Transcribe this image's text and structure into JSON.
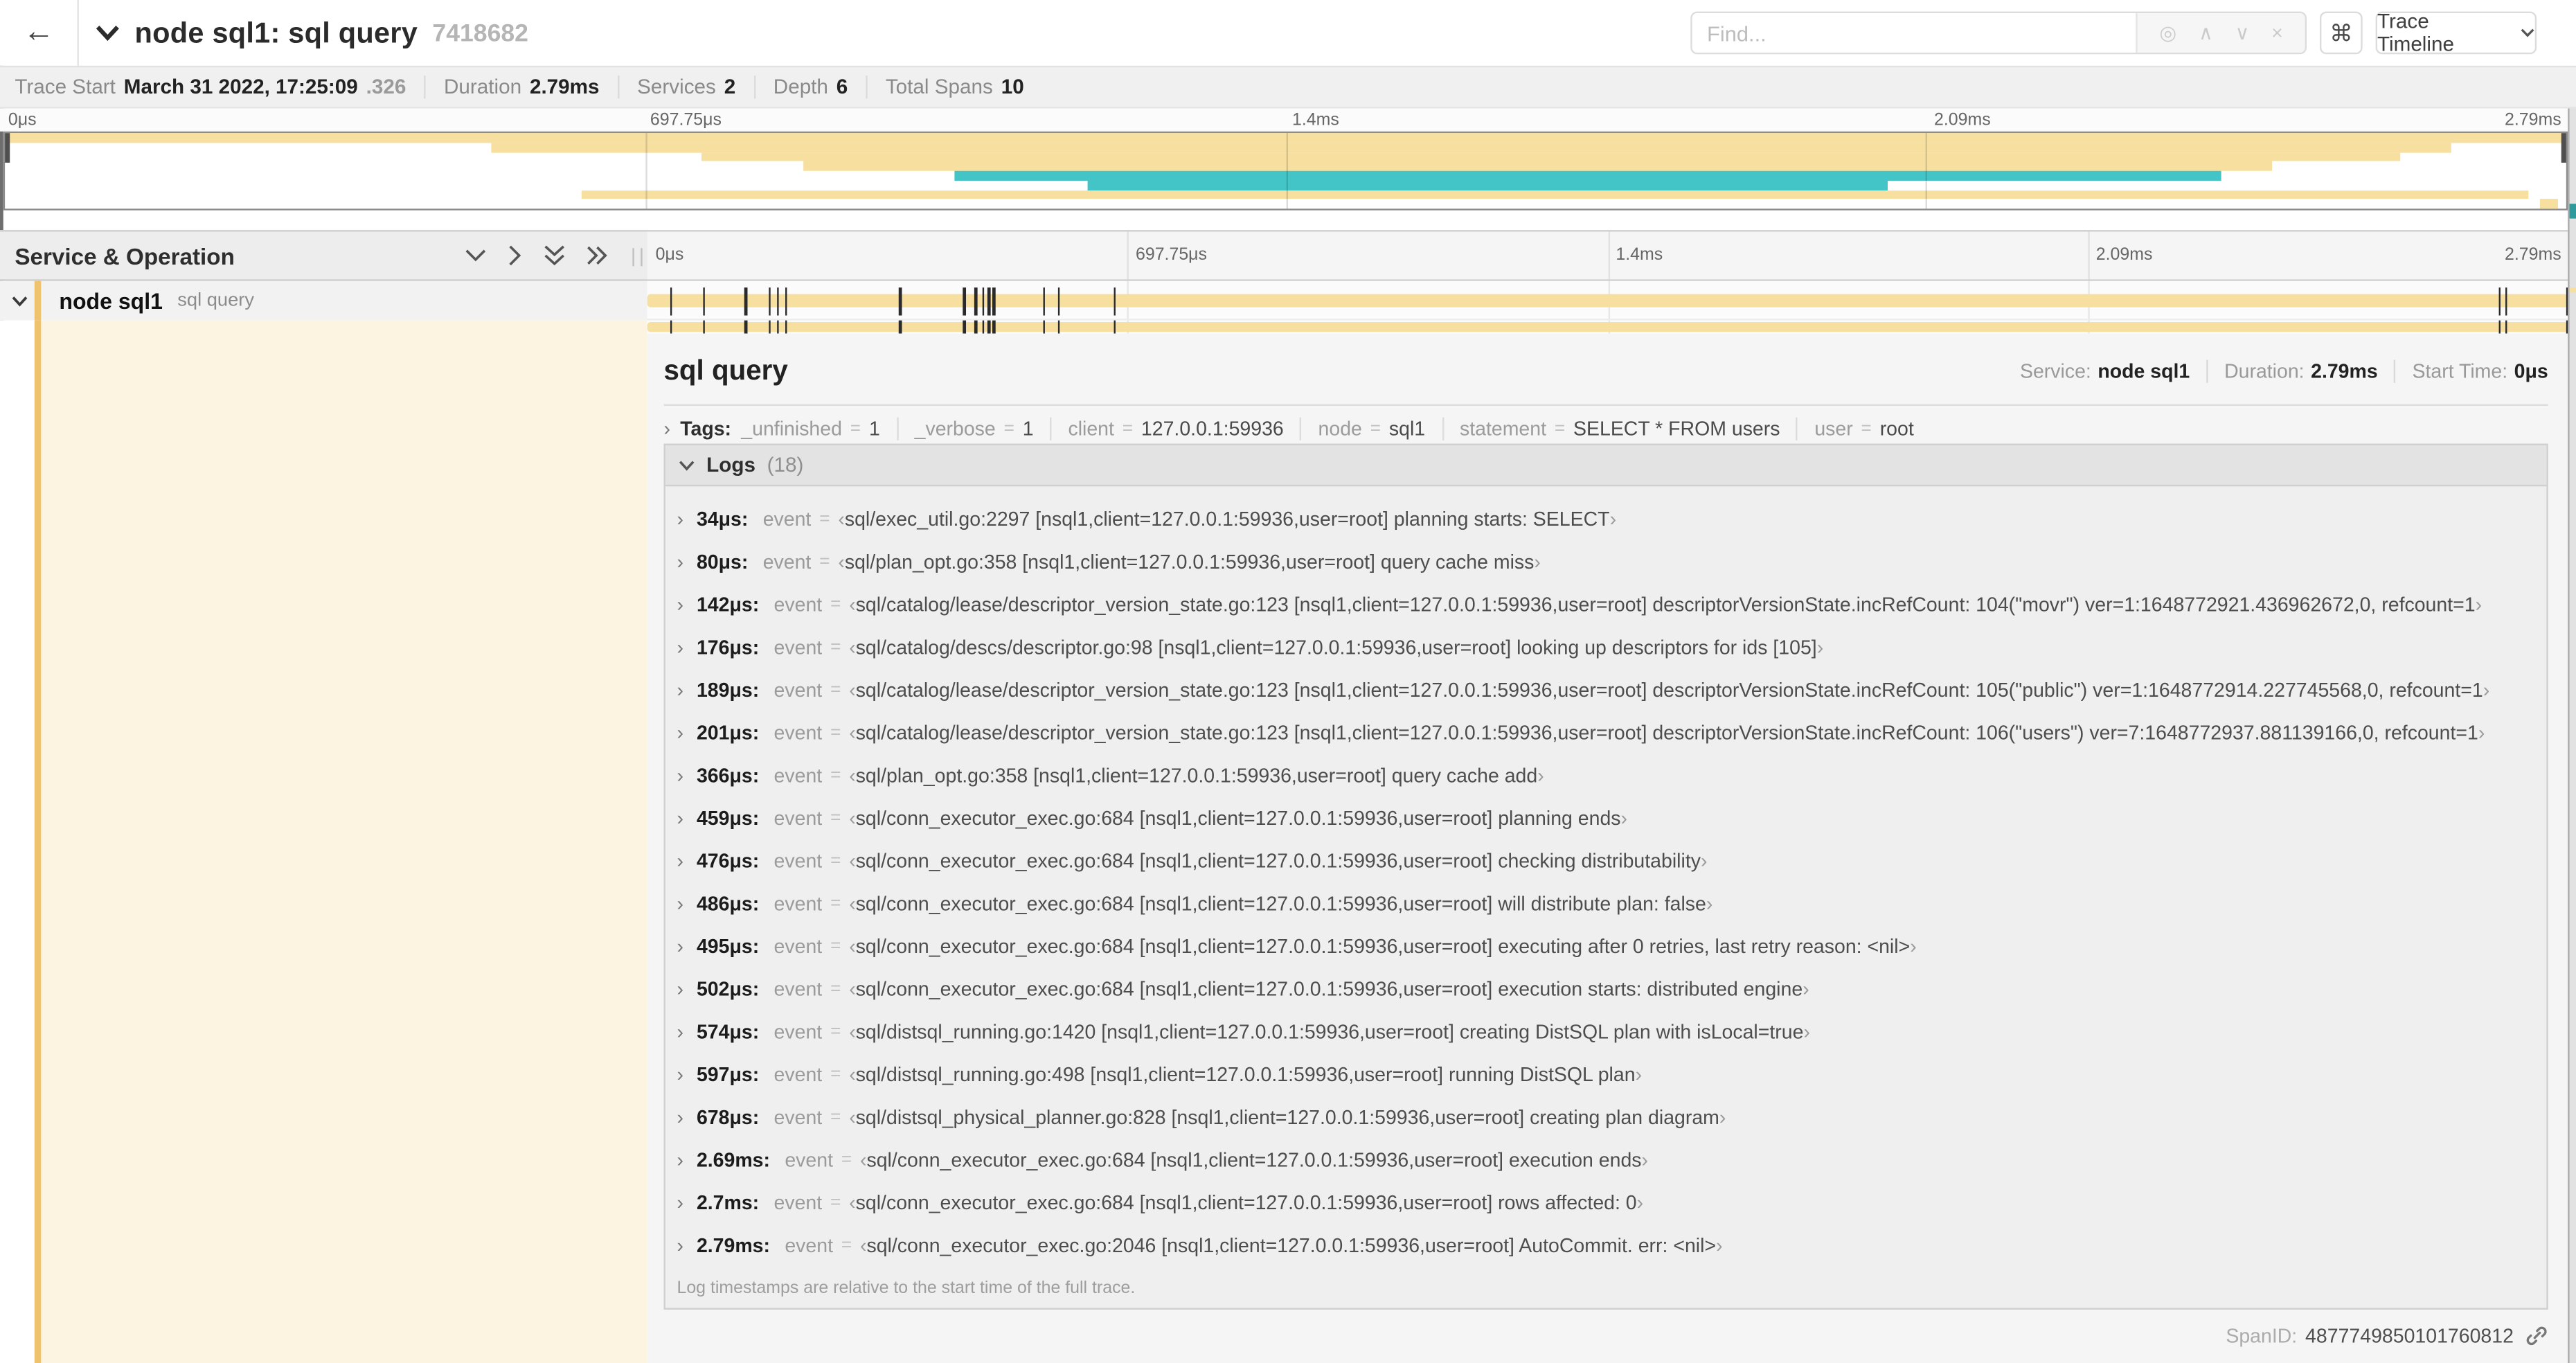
{
  "colors": {
    "tan": "#F7DF9F",
    "teal": "#43C4C6",
    "accent": "#EFC26D",
    "cream": "#FCF4E1"
  },
  "header": {
    "back_arrow": "←",
    "title": "node sql1: sql query",
    "trace_id": "7418682",
    "find_placeholder": "Find...",
    "find_tool_icons": [
      "locate-icon",
      "prev-icon",
      "next-icon",
      "clear-icon"
    ],
    "keyboard_shortcut": "⌘",
    "view_selector": "Trace Timeline"
  },
  "stats": [
    {
      "label": "Trace Start",
      "value": "March 31 2022, 17:25:09",
      "suffix": ".326"
    },
    {
      "label": "Duration",
      "value": "2.79ms",
      "suffix": ""
    },
    {
      "label": "Services",
      "value": "2",
      "suffix": ""
    },
    {
      "label": "Depth",
      "value": "6",
      "suffix": ""
    },
    {
      "label": "Total Spans",
      "value": "10",
      "suffix": ""
    }
  ],
  "timeline": {
    "ticks": [
      "0μs",
      "697.75μs",
      "1.4ms",
      "2.09ms",
      "2.79ms"
    ],
    "duration_us": 2790,
    "log_ticks_us": [
      34,
      80,
      142,
      176,
      189,
      201,
      366,
      459,
      476,
      486,
      495,
      502,
      574,
      597,
      678,
      2690,
      2700,
      2790
    ]
  },
  "minimap": {
    "rows": [
      {
        "color": "tan",
        "start": 0,
        "end": 100
      },
      {
        "color": "tan",
        "start": 19,
        "end": 95.5
      },
      {
        "color": "tan",
        "start": 27.2,
        "end": 93.5
      },
      {
        "color": "tan",
        "start": 31.2,
        "end": 88.5
      },
      {
        "color": "teal",
        "start": 37.1,
        "end": 86.5
      },
      {
        "color": "teal",
        "start": 42.3,
        "end": 73.5
      },
      {
        "color": "tan",
        "start": 22.5,
        "end": 98.5
      },
      {
        "color": "tan",
        "start": 99,
        "end": 99.7
      }
    ]
  },
  "grid_header": {
    "service_column": "Service & Operation"
  },
  "span_row": {
    "service": "node sql1",
    "operation": "sql query"
  },
  "detail": {
    "title": "sql query",
    "info": [
      {
        "label": "Service:",
        "value": "node sql1"
      },
      {
        "label": "Duration:",
        "value": "2.79ms"
      },
      {
        "label": "Start Time:",
        "value": "0μs"
      }
    ],
    "tags_label": "Tags:",
    "tags": [
      {
        "key": "_unfinished",
        "value": "1"
      },
      {
        "key": "_verbose",
        "value": "1"
      },
      {
        "key": "client",
        "value": "127.0.0.1:59936"
      },
      {
        "key": "node",
        "value": "sql1"
      },
      {
        "key": "statement",
        "value": "SELECT * FROM users"
      },
      {
        "key": "user",
        "value": "root"
      }
    ],
    "logs_label": "Logs",
    "logs_count": "(18)",
    "event_key": "event",
    "logs": [
      {
        "t": "34μs:",
        "msg": "sql/exec_util.go:2297 [nsql1,client=127.0.0.1:59936,user=root] planning starts: SELECT"
      },
      {
        "t": "80μs:",
        "msg": "sql/plan_opt.go:358 [nsql1,client=127.0.0.1:59936,user=root] query cache miss"
      },
      {
        "t": "142μs:",
        "msg": "sql/catalog/lease/descriptor_version_state.go:123 [nsql1,client=127.0.0.1:59936,user=root] descriptorVersionState.incRefCount: 104(\"movr\") ver=1:1648772921.436962672,0, refcount=1"
      },
      {
        "t": "176μs:",
        "msg": "sql/catalog/descs/descriptor.go:98 [nsql1,client=127.0.0.1:59936,user=root] looking up descriptors for ids [105]"
      },
      {
        "t": "189μs:",
        "msg": "sql/catalog/lease/descriptor_version_state.go:123 [nsql1,client=127.0.0.1:59936,user=root] descriptorVersionState.incRefCount: 105(\"public\") ver=1:1648772914.227745568,0, refcount=1"
      },
      {
        "t": "201μs:",
        "msg": "sql/catalog/lease/descriptor_version_state.go:123 [nsql1,client=127.0.0.1:59936,user=root] descriptorVersionState.incRefCount: 106(\"users\") ver=7:1648772937.881139166,0, refcount=1"
      },
      {
        "t": "366μs:",
        "msg": "sql/plan_opt.go:358 [nsql1,client=127.0.0.1:59936,user=root] query cache add"
      },
      {
        "t": "459μs:",
        "msg": "sql/conn_executor_exec.go:684 [nsql1,client=127.0.0.1:59936,user=root] planning ends"
      },
      {
        "t": "476μs:",
        "msg": "sql/conn_executor_exec.go:684 [nsql1,client=127.0.0.1:59936,user=root] checking distributability"
      },
      {
        "t": "486μs:",
        "msg": "sql/conn_executor_exec.go:684 [nsql1,client=127.0.0.1:59936,user=root] will distribute plan: false"
      },
      {
        "t": "495μs:",
        "msg": "sql/conn_executor_exec.go:684 [nsql1,client=127.0.0.1:59936,user=root] executing after 0 retries, last retry reason: <nil>"
      },
      {
        "t": "502μs:",
        "msg": "sql/conn_executor_exec.go:684 [nsql1,client=127.0.0.1:59936,user=root] execution starts: distributed engine"
      },
      {
        "t": "574μs:",
        "msg": "sql/distsql_running.go:1420 [nsql1,client=127.0.0.1:59936,user=root] creating DistSQL plan with isLocal=true"
      },
      {
        "t": "597μs:",
        "msg": "sql/distsql_running.go:498 [nsql1,client=127.0.0.1:59936,user=root] running DistSQL plan"
      },
      {
        "t": "678μs:",
        "msg": "sql/distsql_physical_planner.go:828 [nsql1,client=127.0.0.1:59936,user=root] creating plan diagram"
      },
      {
        "t": "2.69ms:",
        "msg": "sql/conn_executor_exec.go:684 [nsql1,client=127.0.0.1:59936,user=root] execution ends"
      },
      {
        "t": "2.7ms:",
        "msg": "sql/conn_executor_exec.go:684 [nsql1,client=127.0.0.1:59936,user=root] rows affected: 0"
      },
      {
        "t": "2.79ms:",
        "msg": "sql/conn_executor_exec.go:2046 [nsql1,client=127.0.0.1:59936,user=root] AutoCommit. err: <nil>"
      }
    ],
    "logs_footnote": "Log timestamps are relative to the start time of the full trace.",
    "spanid_label": "SpanID:",
    "spanid_value": "4877749850101760812"
  }
}
